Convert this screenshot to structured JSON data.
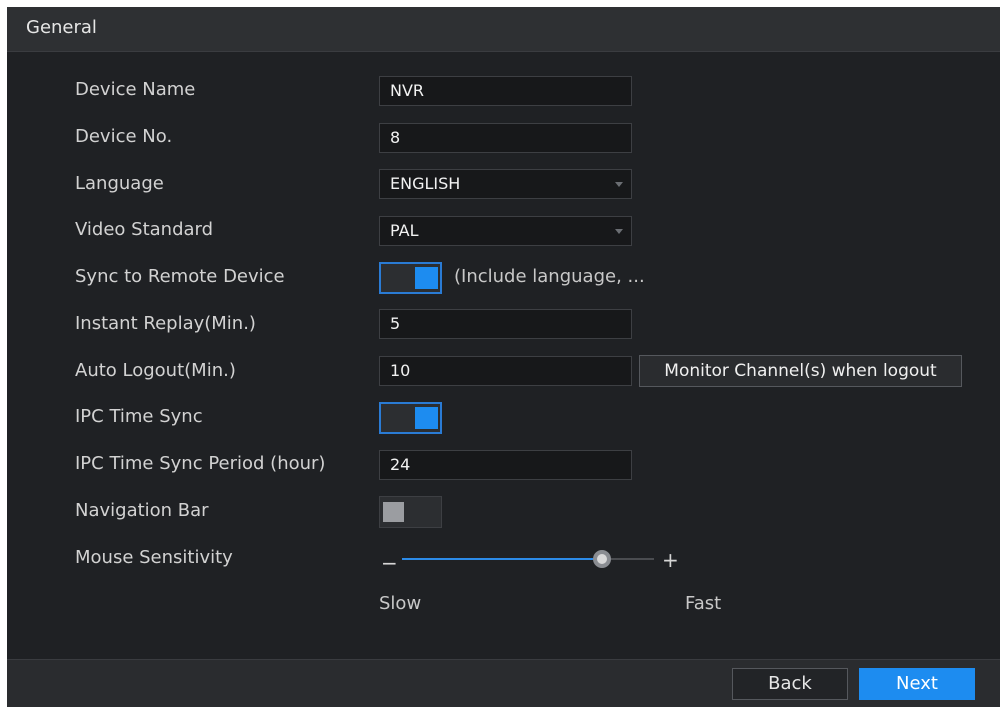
{
  "window": {
    "title": "General"
  },
  "form": {
    "device_name": {
      "label": "Device Name",
      "value": "NVR"
    },
    "device_no": {
      "label": "Device No.",
      "value": "8"
    },
    "language": {
      "label": "Language",
      "value": "ENGLISH"
    },
    "video_standard": {
      "label": "Video Standard",
      "value": "PAL"
    },
    "sync_remote": {
      "label": "Sync to Remote Device",
      "on": true,
      "hint": "(Include language, ..."
    },
    "instant_replay": {
      "label": "Instant Replay(Min.)",
      "value": "5"
    },
    "auto_logout": {
      "label": "Auto Logout(Min.)",
      "value": "10",
      "button": "Monitor Channel(s) when logout"
    },
    "ipc_time_sync": {
      "label": "IPC Time Sync",
      "on": true
    },
    "ipc_sync_period": {
      "label": "IPC Time Sync Period (hour)",
      "value": "24"
    },
    "navigation_bar": {
      "label": "Navigation Bar",
      "on": false
    },
    "mouse_sensitivity": {
      "label": "Mouse Sensitivity",
      "minus": "−",
      "plus": "+",
      "slow": "Slow",
      "fast": "Fast",
      "level": 0.77
    }
  },
  "footer": {
    "back": "Back",
    "next": "Next"
  },
  "colors": {
    "accent": "#1d8cf0",
    "background": "#1f2124",
    "panel": "#2e3033"
  },
  "icons": {
    "dropdown": "caret-down-icon"
  }
}
